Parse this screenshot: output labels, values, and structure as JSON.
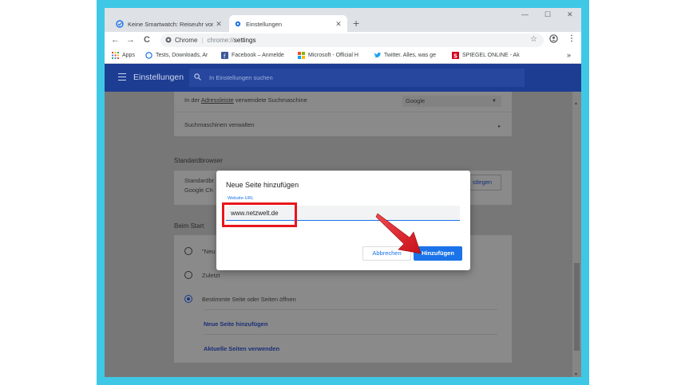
{
  "tabs": [
    {
      "title": "Keine Smartwatch: Reiseuhr von",
      "close": "✕",
      "icon": "chrome-cleaner-icon"
    },
    {
      "title": "Einstellungen",
      "close": "✕",
      "icon": "gear-icon"
    }
  ],
  "new_tab": "+",
  "window_controls": {
    "minimize": "—",
    "maximize": "☐",
    "close": "✕"
  },
  "toolbar": {
    "back": "←",
    "forward": "→",
    "reload": "C",
    "site_label": "Chrome",
    "url_scheme": "chrome://",
    "url_path": "settings",
    "star": "☆",
    "menu": "⋮"
  },
  "bookmarks": [
    {
      "label": "Apps",
      "color": "#e94235"
    },
    {
      "label": "Tests, Downloads, Ar",
      "color": "#1a73e8"
    },
    {
      "label": "Facebook – Anmelde",
      "color": "#3b5998"
    },
    {
      "label": "Microsoft - Official H",
      "color": "#f25022"
    },
    {
      "label": "Twitter. Alles, was ge",
      "color": "#1da1f2"
    },
    {
      "label": "SPIEGEL ONLINE - Ak",
      "color": "#d4001e"
    }
  ],
  "bookmarks_more": "»",
  "settings": {
    "title": "Einstellungen",
    "search_placeholder": "In Einstellungen suchen"
  },
  "search_engine": {
    "label_prefix": "In der ",
    "label_link": "Adressleiste",
    "label_suffix": " verwendete Suchmaschine",
    "value": "Google",
    "manage": "Suchmaschinen verwalten"
  },
  "default_browser": {
    "heading": "Standardbrowser",
    "line1": "Standardbr",
    "line2": "Google Ch",
    "button": "stlegen"
  },
  "startup": {
    "heading": "Beim Start",
    "options": [
      {
        "label": "\"Neu",
        "selected": false
      },
      {
        "label": "Zuletzt",
        "selected": false
      },
      {
        "label": "Bestimmte Seite oder Seiten öffnen",
        "selected": true
      }
    ],
    "link_add": "Neue Seite hinzufügen",
    "link_current": "Aktuelle Seiten verwenden"
  },
  "dialog": {
    "title": "Neue Seite hinzufügen",
    "field_label": "Website-URL",
    "field_value": "www.netzwelt.de",
    "cancel": "Abbrechen",
    "confirm": "Hinzufügen"
  },
  "colors": {
    "accent": "#1a73e8",
    "header": "#1d3d93",
    "annotation": "#e8161b",
    "backdrop": "#3fc8e6"
  }
}
